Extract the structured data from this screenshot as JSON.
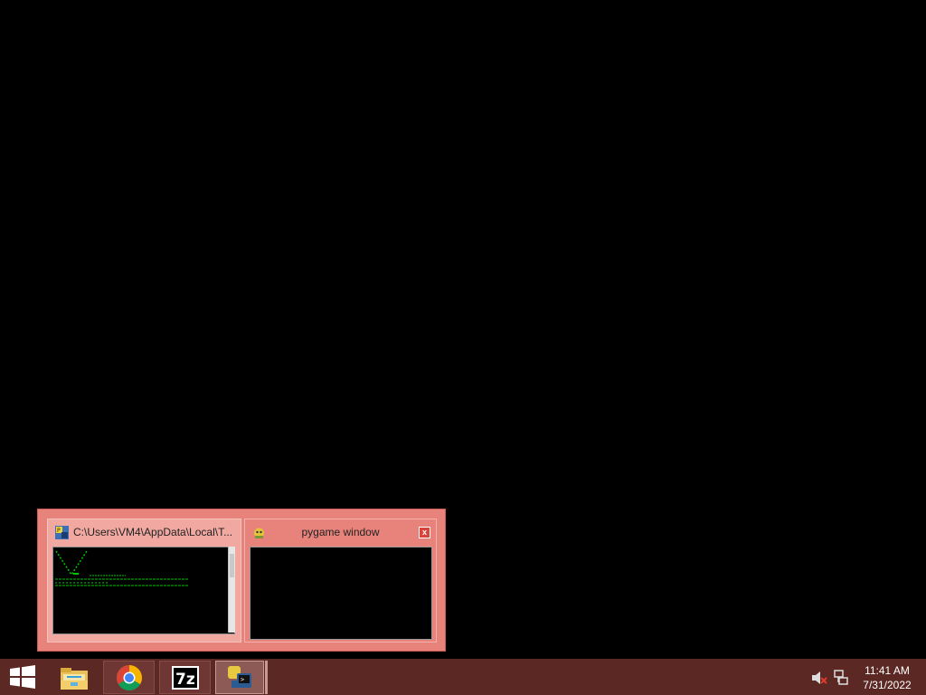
{
  "thumbnails": {
    "console": {
      "title": "C:\\Users\\VM4\\AppData\\Local\\T...",
      "icon": "python-console-icon"
    },
    "pygame": {
      "title": "pygame window",
      "icon": "pygame-icon",
      "close_label": "x"
    }
  },
  "taskbar": {
    "buttons": [
      {
        "name": "start",
        "icon": "windows-logo-icon"
      },
      {
        "name": "file-explorer",
        "icon": "folder-icon"
      },
      {
        "name": "chrome",
        "icon": "chrome-icon"
      },
      {
        "name": "7-zip",
        "icon": "7z-icon",
        "label": "7z"
      },
      {
        "name": "python",
        "icon": "python-icon"
      }
    ],
    "tray": {
      "volume_icon": "volume-muted-icon",
      "network_icon": "network-icon"
    },
    "clock": {
      "time": "11:41 AM",
      "date": "7/31/2022"
    }
  },
  "colors": {
    "taskbar": "#5b2824",
    "thumbnail_frame": "#e8837b",
    "console_text": "#00c800"
  }
}
